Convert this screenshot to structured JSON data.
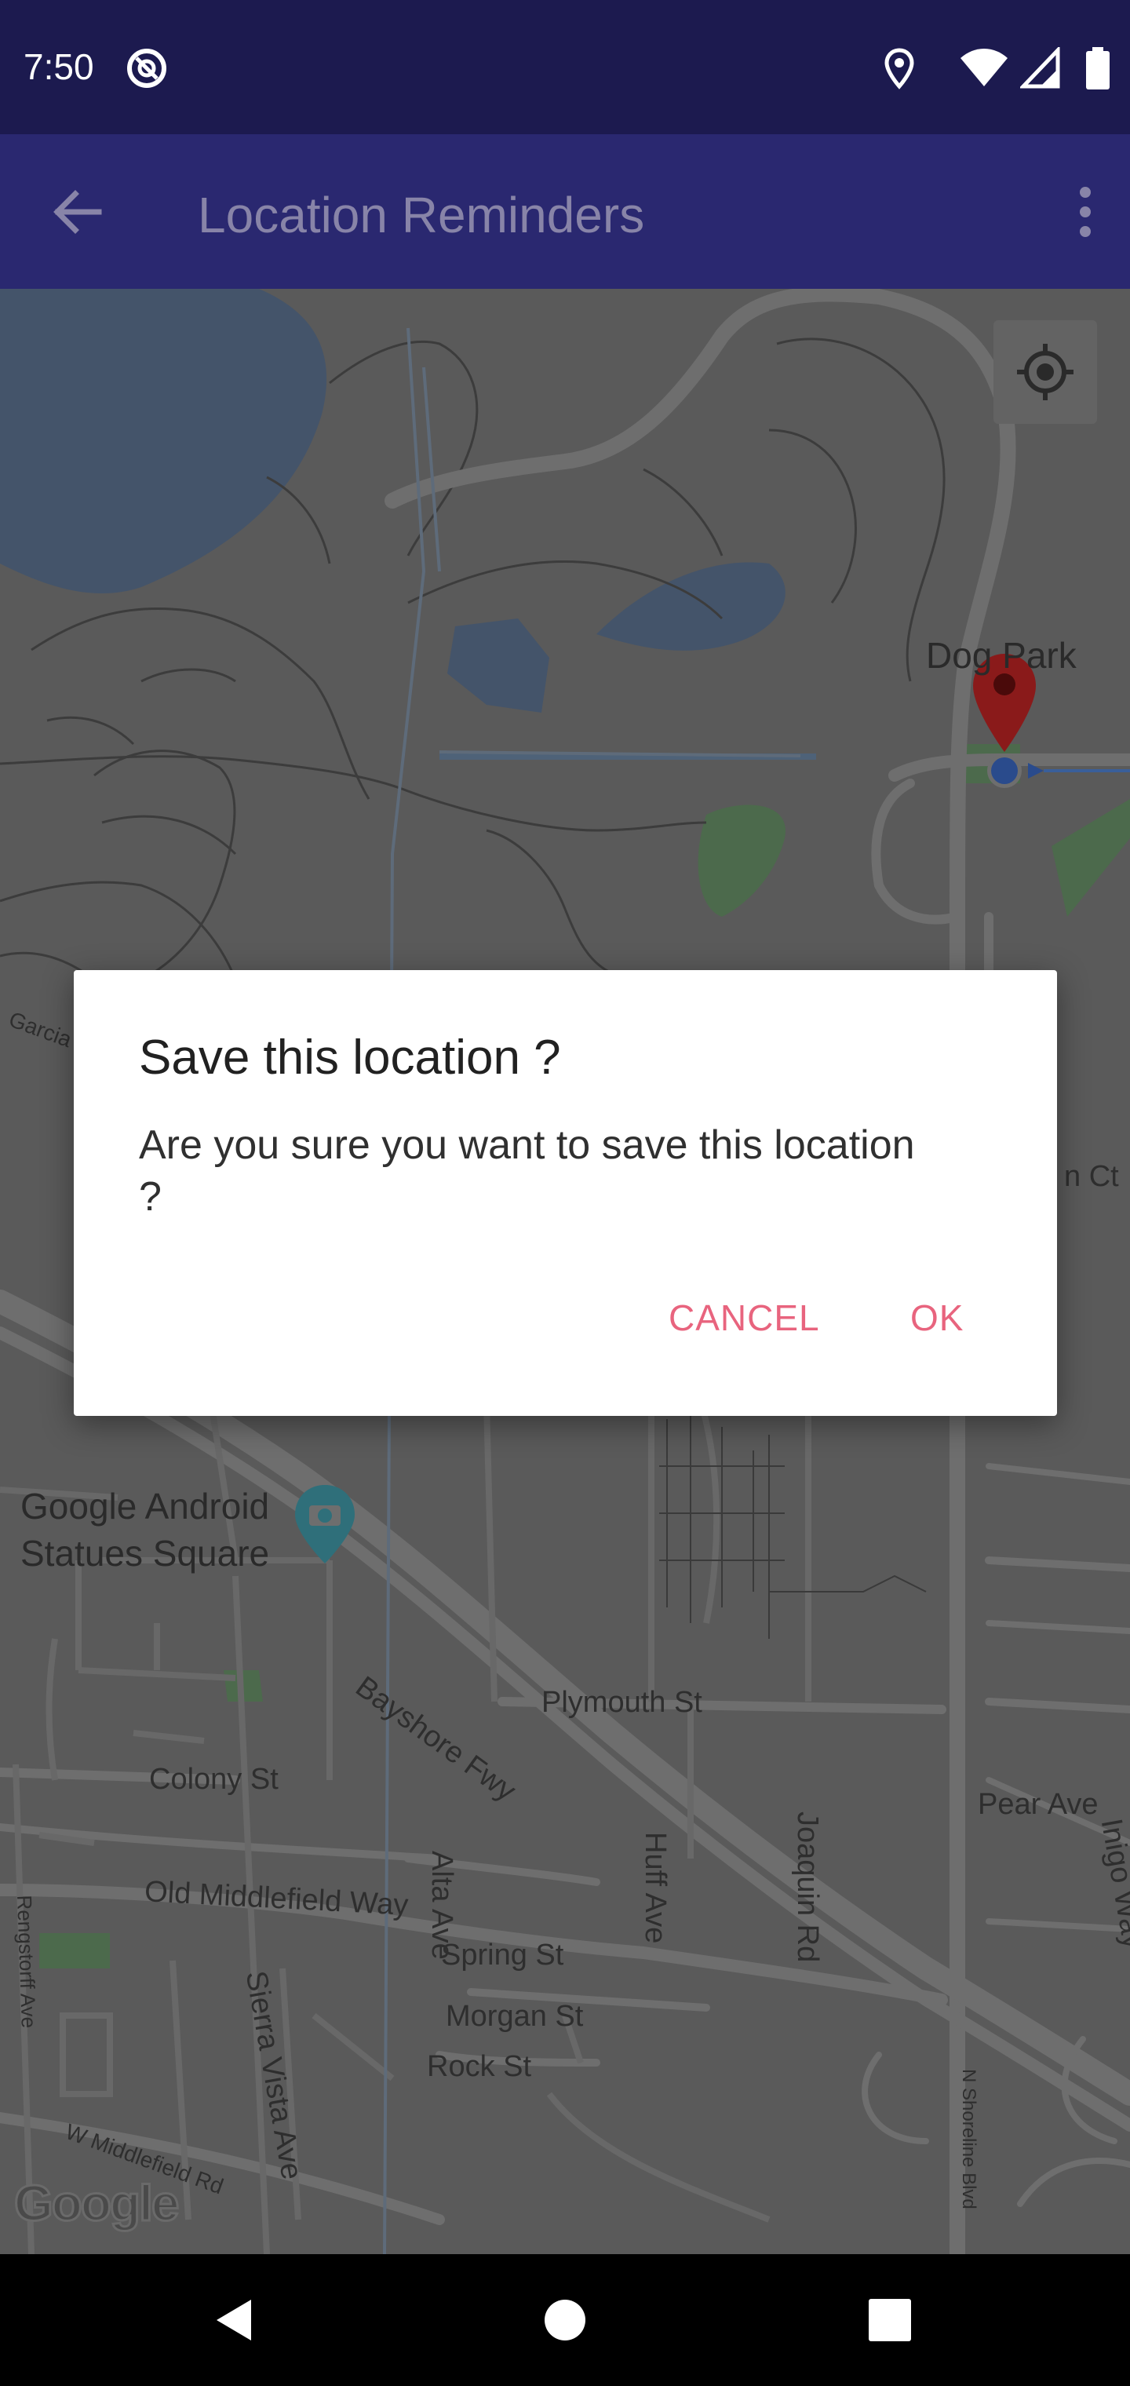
{
  "status_bar": {
    "time": "7:50",
    "icons": [
      "app-notification-icon",
      "location-icon",
      "wifi-icon",
      "signal-icon",
      "battery-icon"
    ]
  },
  "app_bar": {
    "title": "Location Reminders",
    "back_icon": "arrow-back-icon",
    "menu_icon": "more-vert-icon"
  },
  "map": {
    "labels": {
      "dog_park": "Dog Park",
      "garcia": "Garcia",
      "n_ct": "n Ct",
      "google_android": "Google Android",
      "statues_square": "Statues Square",
      "alta_ave": "Alta Ave",
      "huff_ave": "Huff Ave",
      "joaquin_rd": "Joaquin Rd",
      "bayshore_fwy": "Bayshore Fwy",
      "plymouth_st": "Plymouth St",
      "colony_st": "Colony St",
      "pear_ave": "Pear Ave",
      "inigo_way": "Inigo Way",
      "old_middlefield_way": "Old Middlefield Way",
      "spring_st": "Spring St",
      "morgan_st": "Morgan St",
      "rock_st": "Rock St",
      "rengstorff_ave": "Rengstorff Ave",
      "sierra_vista_ave": "Sierra Vista Ave",
      "w_middlefield_rd": "W Middlefield Rd",
      "n_shoreline_blvd": "N Shoreline Blvd"
    },
    "logo": "Google",
    "colors": {
      "land": "#5a5a5a",
      "water": "#44546a",
      "park": "#4c6a4c",
      "road": "#6e6e6e",
      "marker": "#8a1a1a"
    }
  },
  "dialog": {
    "title": "Save this location ?",
    "message": "Are you sure you want to save this location ?",
    "cancel_label": "CANCEL",
    "ok_label": "OK",
    "accent_color": "#e8647e"
  },
  "nav_bar": {
    "icons": [
      "back-triangle-icon",
      "home-circle-icon",
      "recents-square-icon"
    ]
  }
}
